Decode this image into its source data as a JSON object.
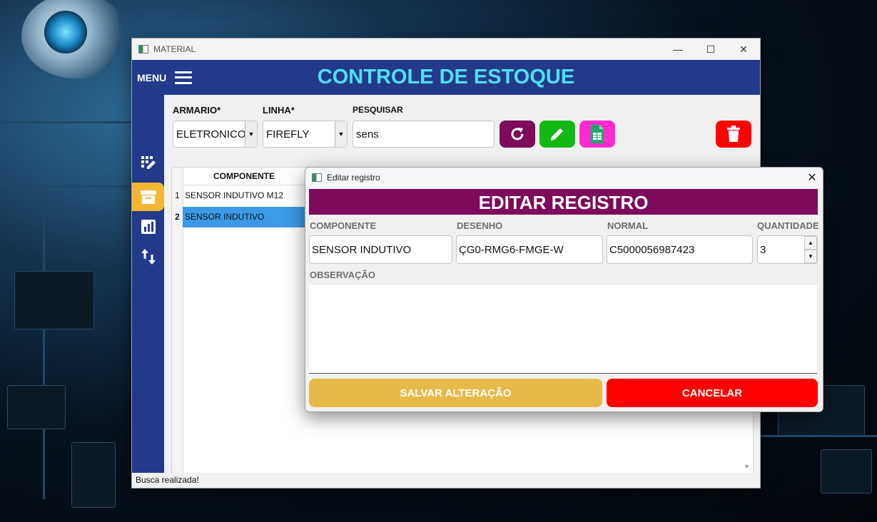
{
  "window": {
    "title": "MATERIAL",
    "menu_label": "MENU",
    "app_title": "CONTROLE DE ESTOQUE"
  },
  "sidebar": {
    "items": [
      {
        "icon": "edit-grid-icon"
      },
      {
        "icon": "archive-box-icon",
        "active": true
      },
      {
        "icon": "report-chart-icon"
      },
      {
        "icon": "swap-vertical-icon"
      }
    ]
  },
  "filters": {
    "armario_label": "ARMARIO*",
    "armario_value": "ELETRONICO",
    "linha_label": "LINHA*",
    "linha_value": "FIREFLY",
    "pesquisar_label": "PESQUISAR",
    "pesquisar_value": "sens"
  },
  "actions": {
    "refresh_color": "#7d0a5c",
    "edit_color": "#14b814",
    "sheet_color": "#ff2bd0",
    "delete_color": "#ff0000"
  },
  "table": {
    "column": "COMPONENTE",
    "rows": [
      {
        "num": "1",
        "componente": "SENSOR INDUTIVO M12"
      },
      {
        "num": "2",
        "componente": "SENSOR INDUTIVO",
        "selected": true
      }
    ]
  },
  "status": "Busca realizada!",
  "dialog": {
    "title": "Editar registro",
    "banner": "EDITAR REGISTRO",
    "componente_label": "COMPONENTE",
    "componente_value": "SENSOR INDUTIVO",
    "desenho_label": "DESENHO",
    "desenho_value": "ÇG0-RMG6-FMGE-W",
    "normal_label": "NORMAL",
    "normal_value": "C5000056987423",
    "quantidade_label": "QUANTIDADE",
    "quantidade_value": "3",
    "observacao_label": "OBSERVAÇÃO",
    "observacao_value": "",
    "save_label": "SALVAR ALTERAÇÃO",
    "save_color": "#e7b94a",
    "cancel_label": "CANCELAR",
    "cancel_color": "#ff0000"
  }
}
